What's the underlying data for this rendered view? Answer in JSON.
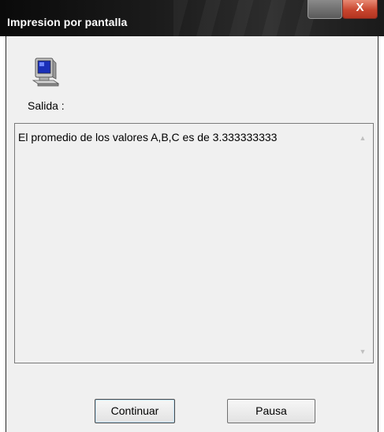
{
  "window": {
    "title": "Impresion por pantalla",
    "close_glyph": "X"
  },
  "icons": {
    "app": "computer-icon"
  },
  "labels": {
    "salida": "Salida :"
  },
  "output": {
    "text": "El promedio de los valores A,B,C es de 3.333333333"
  },
  "buttons": {
    "continuar": "Continuar",
    "pausa": "Pausa"
  },
  "colors": {
    "titlebar": "#111111",
    "client_bg": "#f0f0f0",
    "close_button": "#c8462f"
  }
}
